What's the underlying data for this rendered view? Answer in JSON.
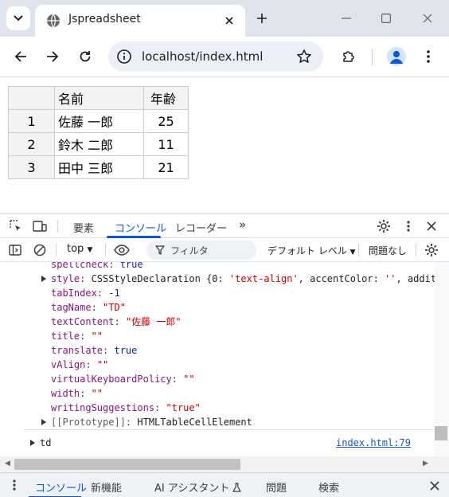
{
  "browser": {
    "tab_title": "Jspreadsheet",
    "url": "localhost/index.html"
  },
  "sheet": {
    "headers": [
      "名前",
      "年齢"
    ],
    "rows": [
      {
        "num": "1",
        "name": "佐藤 一郎",
        "age": "25"
      },
      {
        "num": "2",
        "name": "鈴木 二郎",
        "age": "11"
      },
      {
        "num": "3",
        "name": "田中 三郎",
        "age": "21"
      }
    ]
  },
  "devtools": {
    "tabs": [
      "要素",
      "コンソール",
      "レコーダー"
    ],
    "active_tab": "コンソール",
    "more_tabs": "»",
    "context": "top",
    "filter_placeholder": "フィルタ",
    "levels": "デフォルト レベル",
    "issues": "問題なし",
    "console": {
      "spellcheck_key": "spellcheck",
      "spellcheck_val": "true",
      "style_key": "style",
      "style_val_prefix": "CSSStyleDeclaration {0: ",
      "style_val_str": "'text-align'",
      "style_val_rest": ", accentColor: ",
      "style_val_str2": "''",
      "style_val_rest2": ", additiveS",
      "tabIndex_key": "tabIndex",
      "tabIndex_val": "-1",
      "tagName_key": "tagName",
      "tagName_val": "\"TD\"",
      "textContent_key": "textContent",
      "textContent_val": "\"佐藤 一郎\"",
      "title_key": "title",
      "title_val": "\"\"",
      "translate_key": "translate",
      "translate_val": "true",
      "vAlign_key": "vAlign",
      "vAlign_val": "\"\"",
      "vkp_key": "virtualKeyboardPolicy",
      "vkp_val": "\"\"",
      "width_key": "width",
      "width_val": "\"\"",
      "ws_key": "writingSuggestions",
      "ws_val": "\"true\"",
      "proto_key": "[[Prototype]]",
      "proto_val": "HTMLTableCellElement",
      "td_label": "td",
      "source": "index.html:79"
    },
    "drawer_tabs": [
      "コンソール",
      "新機能",
      "AI アシスタント",
      "問題",
      "検索"
    ]
  }
}
